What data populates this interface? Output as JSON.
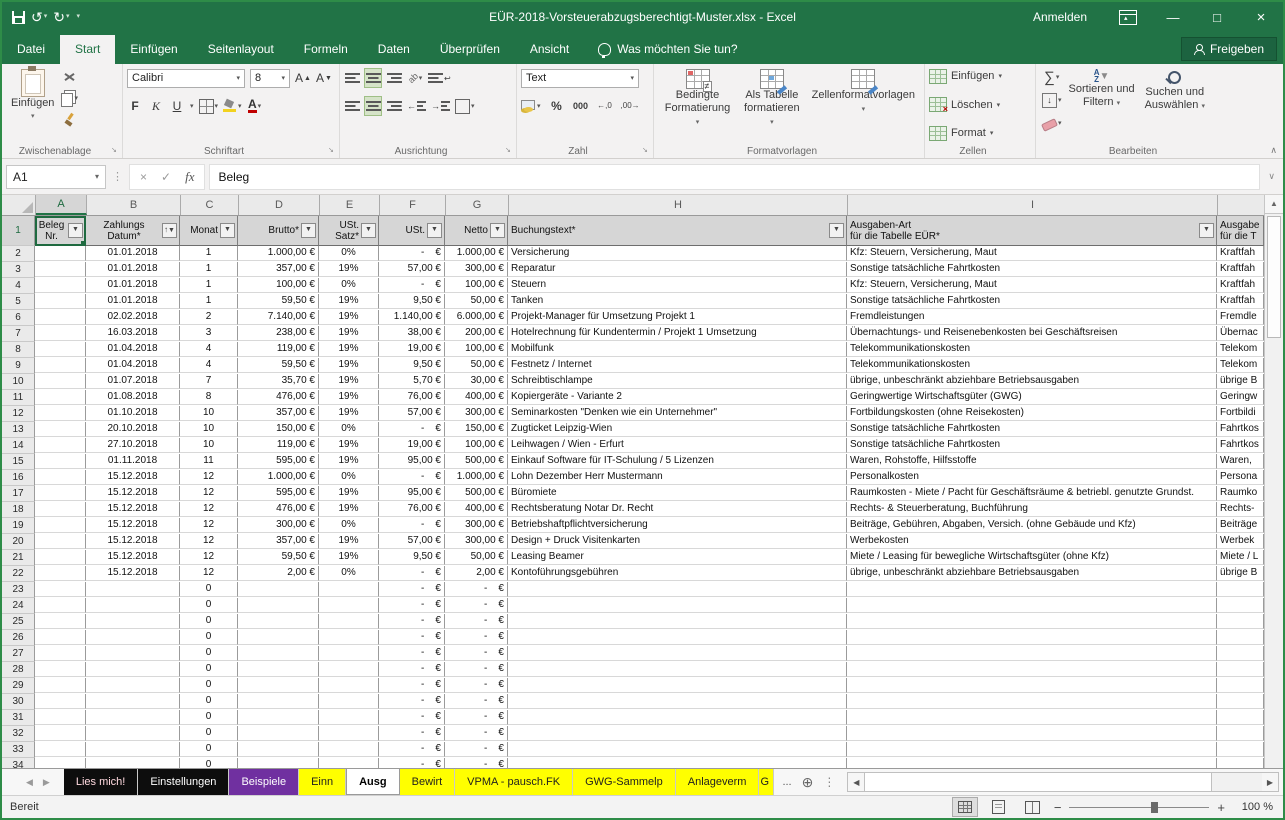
{
  "window": {
    "title": "EÜR-2018-Vorsteuerabzugsberechtigt-Muster.xlsx - Excel",
    "signin": "Anmelden"
  },
  "ribbon_tabs": [
    {
      "label": "Datei",
      "active": false
    },
    {
      "label": "Start",
      "active": true
    },
    {
      "label": "Einfügen",
      "active": false
    },
    {
      "label": "Seitenlayout",
      "active": false
    },
    {
      "label": "Formeln",
      "active": false
    },
    {
      "label": "Daten",
      "active": false
    },
    {
      "label": "Überprüfen",
      "active": false
    },
    {
      "label": "Ansicht",
      "active": false
    }
  ],
  "tellme": {
    "label": "Was möchten Sie tun?"
  },
  "share": {
    "label": "Freigeben"
  },
  "ribbon": {
    "clipboard": {
      "label": "Zwischenablage",
      "paste": "Einfügen"
    },
    "font": {
      "label": "Schriftart",
      "name": "Calibri",
      "size": "8",
      "bold": "F",
      "italic": "K",
      "underline": "U"
    },
    "alignment": {
      "label": "Ausrichtung"
    },
    "number": {
      "label": "Zahl",
      "format": "Text",
      "percent": "%",
      "thousands": "000",
      "dec_inc": "←,0",
      "dec_dec": ",00→"
    },
    "styles": {
      "label": "Formatvorlagen",
      "conditional": [
        "Bedingte",
        "Formatierung"
      ],
      "astable": [
        "Als Tabelle",
        "formatieren"
      ],
      "cellstyles": "Zellenformatvorlagen"
    },
    "cells": {
      "label": "Zellen",
      "insert": "Einfügen",
      "del": "Löschen",
      "format": "Format"
    },
    "editing": {
      "label": "Bearbeiten",
      "sort": [
        "Sortieren und",
        "Filtern"
      ],
      "find": [
        "Suchen und",
        "Auswählen"
      ]
    }
  },
  "formula_bar": {
    "name_box": "A1",
    "value": "Beleg"
  },
  "grid": {
    "columns": [
      "A",
      "B",
      "C",
      "D",
      "E",
      "F",
      "G",
      "H",
      "I",
      ""
    ],
    "header_cells": [
      {
        "col": "A",
        "lines": [
          "Beleg",
          "Nr."
        ],
        "align": "center",
        "filter": true,
        "selected": true
      },
      {
        "col": "B",
        "lines": [
          "Zahlungs",
          "Datum*"
        ],
        "align": "center",
        "filter": true,
        "sorted": true
      },
      {
        "col": "C",
        "lines": [
          "Monat"
        ],
        "align": "right",
        "filter": true
      },
      {
        "col": "D",
        "lines": [
          "Brutto*"
        ],
        "align": "right",
        "filter": true
      },
      {
        "col": "E",
        "lines": [
          "USt.",
          "Satz*"
        ],
        "align": "right",
        "filter": true
      },
      {
        "col": "F",
        "lines": [
          "USt."
        ],
        "align": "right",
        "filter": true
      },
      {
        "col": "G",
        "lines": [
          "Netto"
        ],
        "align": "right",
        "filter": true
      },
      {
        "col": "H",
        "lines": [
          "Buchungstext*"
        ],
        "align": "left",
        "filter": true
      },
      {
        "col": "I",
        "lines": [
          "Ausgaben-Art",
          "für die Tabelle EÜR*"
        ],
        "align": "left",
        "filter": true
      },
      {
        "col": "J",
        "lines": [
          "Ausgabe",
          "für die T"
        ],
        "align": "left",
        "filter": false
      }
    ],
    "rows": [
      [
        "",
        "01.01.2018",
        "1",
        "1.000,00 €",
        "0%",
        "-    €",
        "1.000,00 €",
        "Versicherung",
        "Kfz: Steuern, Versicherung, Maut",
        "Kraftfah"
      ],
      [
        "",
        "01.01.2018",
        "1",
        "357,00 €",
        "19%",
        "57,00 €",
        "300,00 €",
        "Reparatur",
        "Sonstige tatsächliche Fahrtkosten",
        "Kraftfah"
      ],
      [
        "",
        "01.01.2018",
        "1",
        "100,00 €",
        "0%",
        "-    €",
        "100,00 €",
        "Steuern",
        "Kfz: Steuern, Versicherung, Maut",
        "Kraftfah"
      ],
      [
        "",
        "01.01.2018",
        "1",
        "59,50 €",
        "19%",
        "9,50 €",
        "50,00 €",
        "Tanken",
        "Sonstige tatsächliche Fahrtkosten",
        "Kraftfah"
      ],
      [
        "",
        "02.02.2018",
        "2",
        "7.140,00 €",
        "19%",
        "1.140,00 €",
        "6.000,00 €",
        "Projekt-Manager für Umsetzung Projekt 1",
        "Fremdleistungen",
        "Fremdle"
      ],
      [
        "",
        "16.03.2018",
        "3",
        "238,00 €",
        "19%",
        "38,00 €",
        "200,00 €",
        "Hotelrechnung für Kundentermin / Projekt 1 Umsetzung",
        "Übernachtungs- und Reisenebenkosten bei Geschäftsreisen",
        "Übernac"
      ],
      [
        "",
        "01.04.2018",
        "4",
        "119,00 €",
        "19%",
        "19,00 €",
        "100,00 €",
        "Mobilfunk",
        "Telekommunikationskosten",
        "Telekom"
      ],
      [
        "",
        "01.04.2018",
        "4",
        "59,50 €",
        "19%",
        "9,50 €",
        "50,00 €",
        "Festnetz / Internet",
        "Telekommunikationskosten",
        "Telekom"
      ],
      [
        "",
        "01.07.2018",
        "7",
        "35,70 €",
        "19%",
        "5,70 €",
        "30,00 €",
        "Schreibtischlampe",
        "übrige, unbeschränkt abziehbare Betriebsausgaben",
        "übrige B"
      ],
      [
        "",
        "01.08.2018",
        "8",
        "476,00 €",
        "19%",
        "76,00 €",
        "400,00 €",
        "Kopiergeräte - Variante 2",
        "Geringwertige Wirtschaftsgüter (GWG)",
        "Geringw"
      ],
      [
        "",
        "01.10.2018",
        "10",
        "357,00 €",
        "19%",
        "57,00 €",
        "300,00 €",
        "Seminarkosten \"Denken wie ein Unternehmer\"",
        "Fortbildungskosten (ohne Reisekosten)",
        "Fortbildi"
      ],
      [
        "",
        "20.10.2018",
        "10",
        "150,00 €",
        "0%",
        "-    €",
        "150,00 €",
        "Zugticket Leipzig-Wien",
        "Sonstige tatsächliche Fahrtkosten",
        "Fahrtkos"
      ],
      [
        "",
        "27.10.2018",
        "10",
        "119,00 €",
        "19%",
        "19,00 €",
        "100,00 €",
        "Leihwagen / Wien - Erfurt",
        "Sonstige tatsächliche Fahrtkosten",
        "Fahrtkos"
      ],
      [
        "",
        "01.11.2018",
        "11",
        "595,00 €",
        "19%",
        "95,00 €",
        "500,00 €",
        "Einkauf Software für IT-Schulung / 5 Lizenzen",
        "Waren, Rohstoffe, Hilfsstoffe",
        "Waren,"
      ],
      [
        "",
        "15.12.2018",
        "12",
        "1.000,00 €",
        "0%",
        "-    €",
        "1.000,00 €",
        "Lohn Dezember Herr Mustermann",
        "Personalkosten",
        "Persona"
      ],
      [
        "",
        "15.12.2018",
        "12",
        "595,00 €",
        "19%",
        "95,00 €",
        "500,00 €",
        "Büromiete",
        "Raumkosten - Miete / Pacht für Geschäftsräume & betriebl. genutzte Grundst.",
        "Raumko"
      ],
      [
        "",
        "15.12.2018",
        "12",
        "476,00 €",
        "19%",
        "76,00 €",
        "400,00 €",
        "Rechtsberatung Notar Dr. Recht",
        "Rechts- & Steuerberatung, Buchführung",
        "Rechts-"
      ],
      [
        "",
        "15.12.2018",
        "12",
        "300,00 €",
        "0%",
        "-    €",
        "300,00 €",
        "Betriebshaftpflichtversicherung",
        "Beiträge, Gebühren, Abgaben, Versich. (ohne Gebäude und Kfz)",
        "Beiträge"
      ],
      [
        "",
        "15.12.2018",
        "12",
        "357,00 €",
        "19%",
        "57,00 €",
        "300,00 €",
        "Design + Druck Visitenkarten",
        "Werbekosten",
        "Werbek"
      ],
      [
        "",
        "15.12.2018",
        "12",
        "59,50 €",
        "19%",
        "9,50 €",
        "50,00 €",
        "Leasing Beamer",
        "Miete / Leasing für bewegliche Wirtschaftsgüter (ohne Kfz)",
        "Miete / L"
      ],
      [
        "",
        "15.12.2018",
        "12",
        "2,00 €",
        "0%",
        "-    €",
        "2,00 €",
        "Kontoführungsgebühren",
        "übrige, unbeschränkt abziehbare Betriebsausgaben",
        "übrige B"
      ]
    ],
    "empty_rows": {
      "start": 23,
      "count": 14,
      "monat": "0",
      "dash": "-    €"
    }
  },
  "sheet_tabs": {
    "tabs": [
      {
        "label": "Lies mich!",
        "bg": "#0d0d0d",
        "fg": "#ffd9df",
        "active": false
      },
      {
        "label": "Einstellungen",
        "bg": "#0d0d0d",
        "fg": "#ffffff",
        "active": false
      },
      {
        "label": "Beispiele",
        "bg": "#7030a0",
        "fg": "#ffffff",
        "active": false
      },
      {
        "label": "Einn",
        "bg": "#ffff00",
        "fg": "#1f1f1f",
        "active": false
      },
      {
        "label": "Ausg",
        "bg": "#ffffff",
        "fg": "#000000",
        "active": true
      },
      {
        "label": "Bewirt",
        "bg": "#ffff00",
        "fg": "#1f1f1f",
        "active": false
      },
      {
        "label": "VPMA - pausch.FK",
        "bg": "#ffff00",
        "fg": "#1f1f1f",
        "active": false
      },
      {
        "label": "GWG-Sammelp",
        "bg": "#ffff00",
        "fg": "#1f1f1f",
        "active": false
      },
      {
        "label": "Anlageverm",
        "bg": "#ffff00",
        "fg": "#1f1f1f",
        "active": false
      },
      {
        "label": "G",
        "bg": "#ffff00",
        "fg": "#1f1f1f",
        "active": false,
        "partial": true
      }
    ],
    "overflow": "..."
  },
  "status": {
    "mode": "Bereit",
    "zoom": "100 %"
  }
}
